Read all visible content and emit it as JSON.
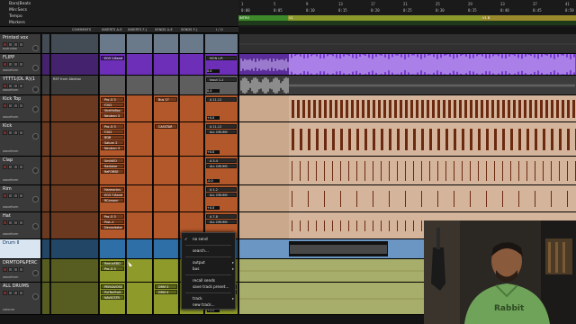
{
  "ruler": {
    "labels": [
      "Bars|Beats",
      "Min:Secs",
      "Tempo",
      "Markers"
    ],
    "bars": [
      "1",
      "5",
      "9",
      "13",
      "17",
      "21",
      "25",
      "29",
      "33",
      "37",
      "41"
    ],
    "secs": [
      "0:00",
      "0:05",
      "0:10",
      "0:15",
      "0:20",
      "0:25",
      "0:30",
      "0:35",
      "0:40",
      "0:45",
      "0:50"
    ],
    "markers": [
      {
        "label": "INTRO",
        "color": "#5bbf3c"
      },
      {
        "label": "V1",
        "color": "#b9c73a"
      },
      {
        "label": "V1 B",
        "color": "#c9b93c"
      }
    ]
  },
  "columns": [
    "COMMENTS",
    "INSERTS A-E",
    "INSERTS F-J",
    "SENDS A-E",
    "SENDS F-J",
    "I / O"
  ],
  "tracks": [
    {
      "name": "Printed vox",
      "sub": "overview",
      "color": "#6a7a8a",
      "comment": "",
      "inserts": [],
      "sends": [],
      "io": ""
    },
    {
      "name": "FLIPP",
      "sub": "waveform",
      "color": "#6e2fb8",
      "comment": "",
      "inserts": [
        "EQ3 1-Band"
      ],
      "sends": [],
      "io": "MON L/R",
      "vol": "0.0"
    },
    {
      "name": "YTTT1(DL R)(1",
      "sub": "waveform",
      "color": "#5e5e5e",
      "comment": "REF from Ableton",
      "inserts": [],
      "sends": [],
      "io": "Input 1-2",
      "vol": "0.0"
    },
    {
      "name": "Kick Top",
      "sub": "waveform",
      "color": "#b3582a",
      "comment": "",
      "inserts": [
        "Pro-Q 3",
        "F202",
        "ShelfixBox",
        "Neutron 3"
      ],
      "sends": [
        "Bus 17"
      ],
      "io": "A 11-12",
      "vol": "+0.0"
    },
    {
      "name": "Kick",
      "sub": "waveform",
      "color": "#b3582a",
      "comment": "",
      "inserts": [
        "Pro-Q 3",
        "F202",
        "BDB",
        "Saturn 2",
        "Neutron 3"
      ],
      "sends": [
        "CASSTAR"
      ],
      "io": "A 11-12",
      "vol": "+0.0",
      "io2": "ALL DRUMS"
    },
    {
      "name": "Clap",
      "sub": "waveform",
      "color": "#b3582a",
      "comment": "",
      "inserts": [
        "SmthEQ",
        "Radiator",
        "ReFORSE"
      ],
      "sends": [],
      "io": "A 3-4",
      "vol": "-0.0",
      "io2": "ALL DRUMS"
    },
    {
      "name": "Rim",
      "sub": "waveform",
      "color": "#b3582a",
      "comment": "",
      "inserts": [
        "Harmonics",
        "EQ3 7-Band",
        "RCompnr"
      ],
      "sends": [],
      "io": "A 1-2",
      "vol": "+0.0",
      "io2": "ALL DRUMS"
    },
    {
      "name": "Hat",
      "sub": "waveform",
      "color": "#b3582a",
      "comment": "",
      "inserts": [
        "Pro-Q 3",
        "ProL-1",
        "Decapitator"
      ],
      "sends": [],
      "io": "A 7-8",
      "vol": "-0.0",
      "io2": "ALL DRUMS"
    },
    {
      "name": "Drum II",
      "sub": "",
      "color": "#2f6fa8",
      "comment": "",
      "inserts": [],
      "sends": [],
      "io": "",
      "vol": ""
    },
    {
      "name": "DRMTOP&PERC",
      "sub": "waveform",
      "color": "#8e9a2a",
      "comment": "",
      "inserts": [
        "ReduxEBD",
        "Pro-Q 3"
      ],
      "sends": [],
      "io": "",
      "vol": ""
    },
    {
      "name": "ALL DRUMS",
      "sub": "volume",
      "color": "#8e9a2a",
      "comment": "",
      "inserts": [
        "PEEKAVOSE",
        "PulTecProG",
        "NAVICSTR"
      ],
      "sends": [
        "DRM 3",
        "DRM 4"
      ],
      "io": "DRUMS",
      "io2": "ShelfixBox",
      "vol": "+0.0"
    }
  ],
  "context_menu": {
    "items": [
      {
        "label": "no send",
        "checked": true
      },
      {
        "label": "search..."
      },
      {
        "label": "output",
        "submenu": true
      },
      {
        "label": "bus",
        "submenu": true
      },
      {
        "label": "recall sends"
      },
      {
        "label": "save track preset..."
      },
      {
        "label": "track",
        "submenu": true
      },
      {
        "label": "new track..."
      }
    ]
  },
  "colors": {
    "purple": "#6e2fb8",
    "orange": "#b3582a",
    "olive": "#8e9a2a",
    "blue": "#2f6fa8",
    "gray": "#5e5e5e"
  }
}
